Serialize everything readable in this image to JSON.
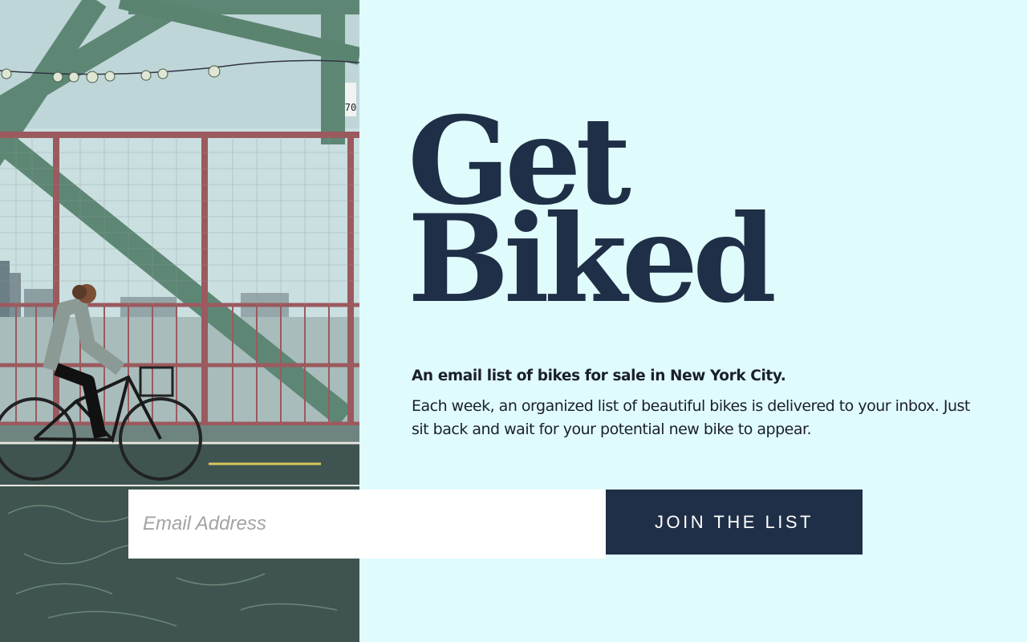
{
  "hero": {
    "headline_line1": "Get",
    "headline_line2": "Biked",
    "tagline": "An email list of bikes for sale in New York City.",
    "description": "Each week, an organized list of beautiful bikes is delivered to your inbox. Just sit back and wait for your potential new bike to appear."
  },
  "photo": {
    "sign_number": "70"
  },
  "signup": {
    "email_placeholder": "Email Address",
    "email_value": "",
    "button_label": "JOIN THE LIST"
  },
  "colors": {
    "background": "#e0fbfb",
    "navy": "#1f2f47",
    "input_bg": "#ffffff"
  }
}
